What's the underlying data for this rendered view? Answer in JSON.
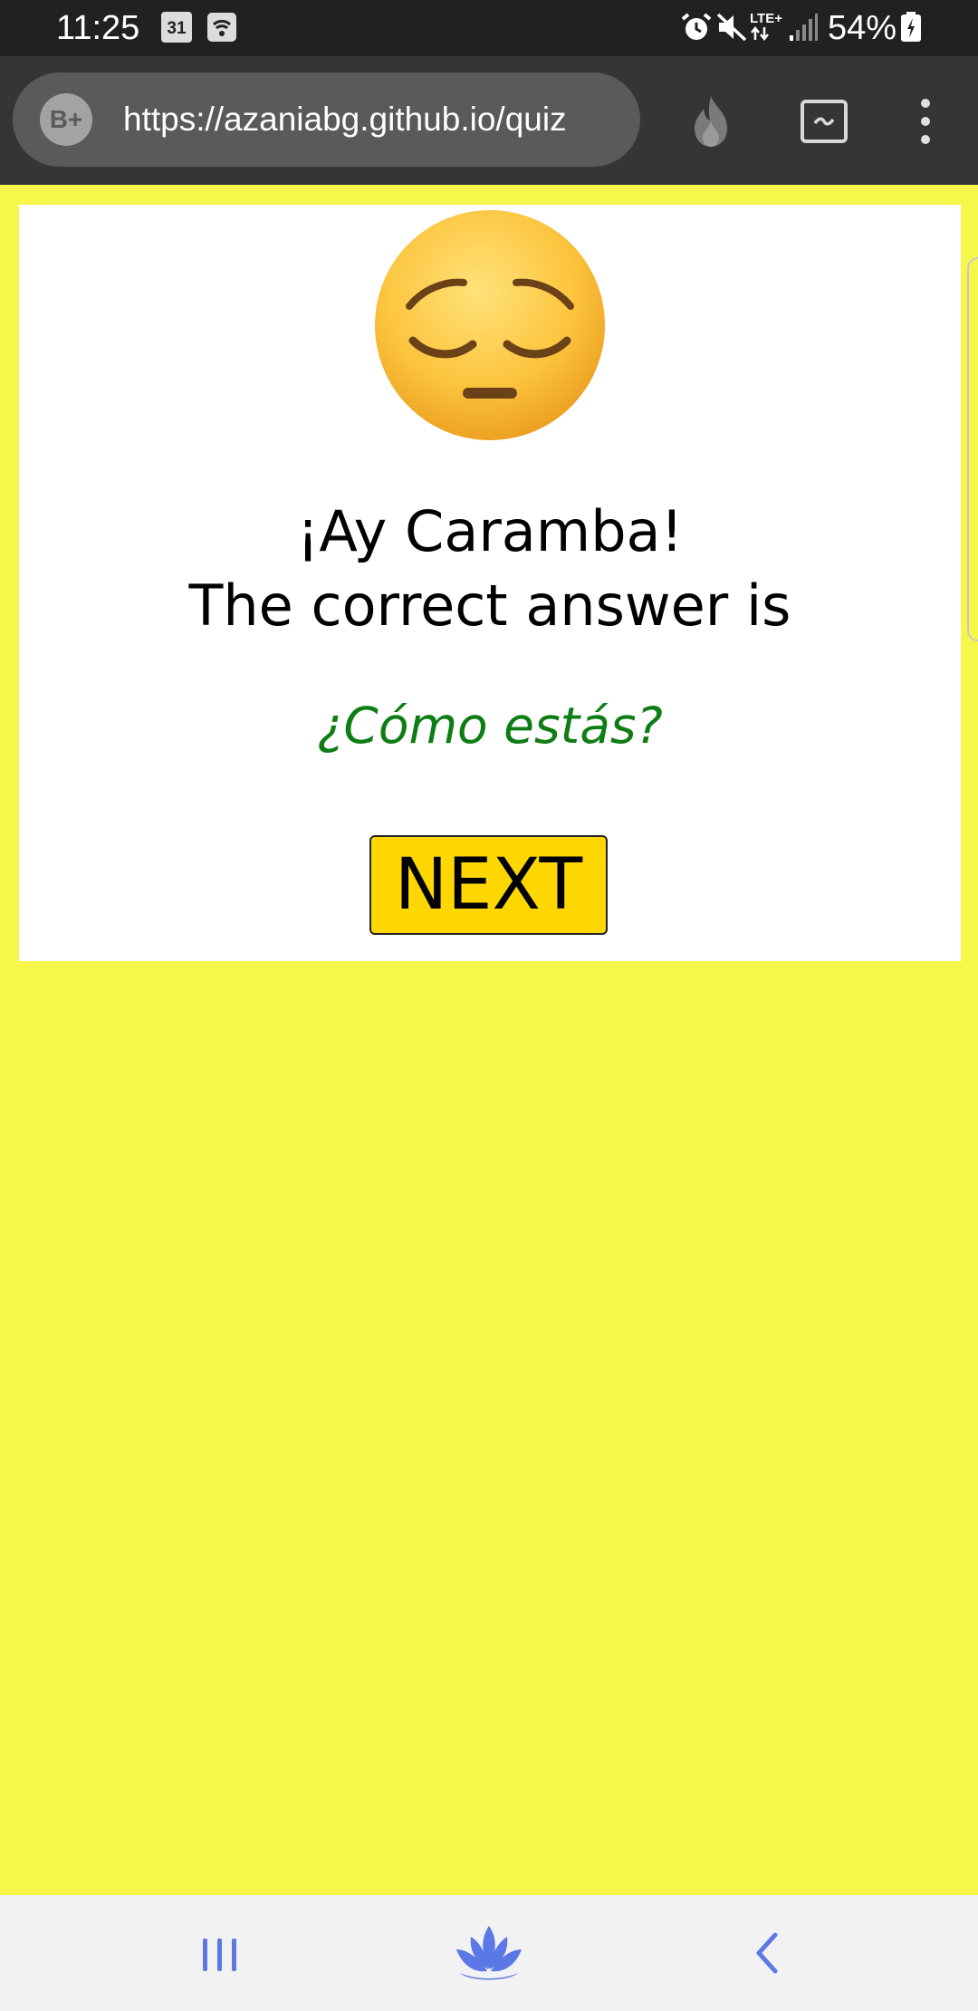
{
  "status_bar": {
    "time": "11:25",
    "calendar_date": "31",
    "lte_label": "LTE+",
    "battery": "54%"
  },
  "browser": {
    "site_badge": "B+",
    "url": "https://azaniabg.github.io/quiz"
  },
  "quiz": {
    "result_emoji": "pensive-face",
    "headline_line1": "¡Ay Caramba!",
    "headline_line2": "The correct answer is",
    "correct_answer": "¿Cómo estás?",
    "next_label": "NEXT"
  },
  "colors": {
    "page_background": "#f7f74b",
    "card_background": "#ffffff",
    "answer_text": "#0d7d14",
    "next_button": "#ffd700",
    "status_bar": "#212121",
    "toolbar": "#353535",
    "nav_icons": "#5b78e6"
  },
  "navigation": {
    "icons": [
      "recents-icon",
      "home-lotus-icon",
      "back-icon"
    ]
  }
}
